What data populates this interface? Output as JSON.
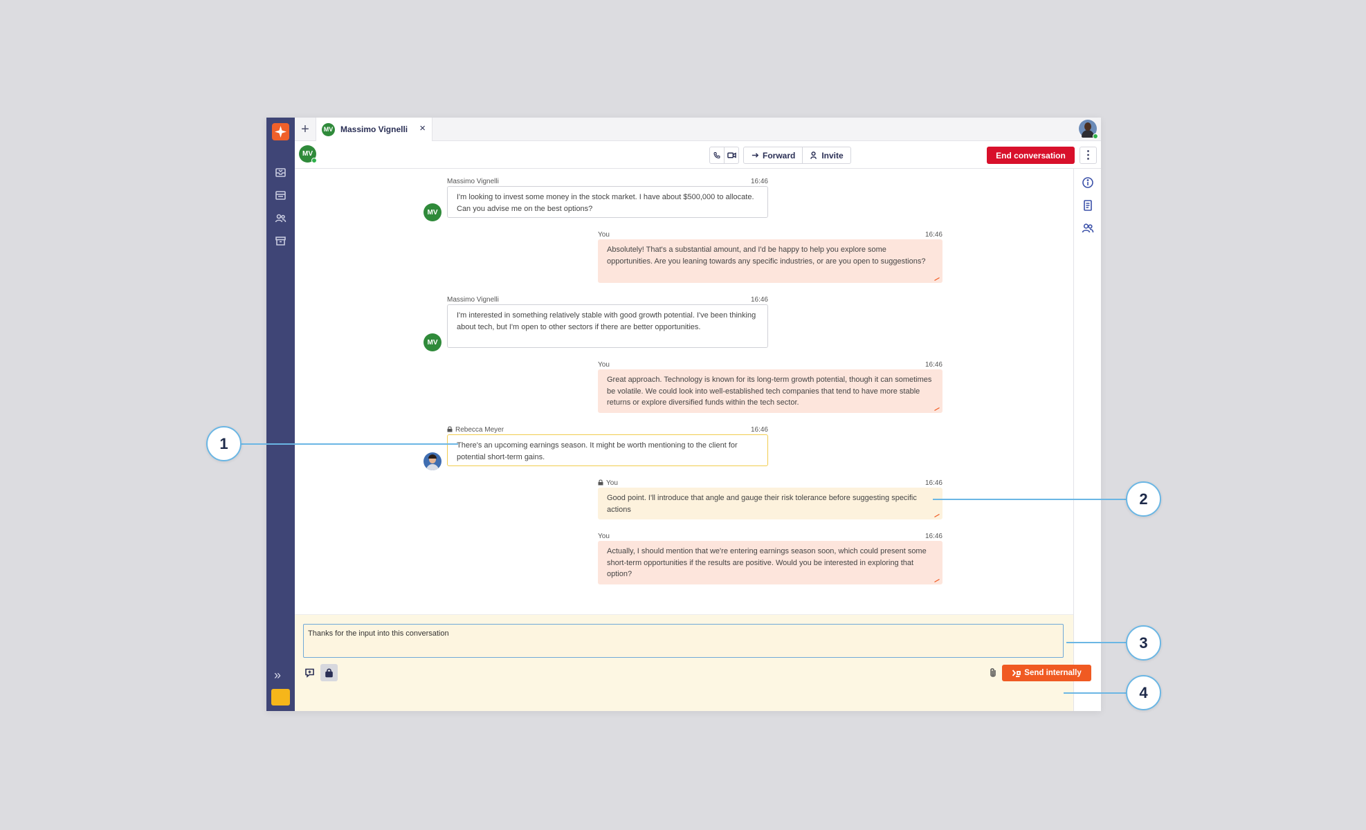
{
  "tabs": {
    "add_label": "+",
    "active": {
      "initials": "MV",
      "name": "Massimo Vignelli",
      "close": "×"
    }
  },
  "header": {
    "contact_initials": "MV",
    "forward_label": "Forward",
    "invite_label": "Invite",
    "end_label": "End conversation",
    "more_label": "⋮"
  },
  "messages": [
    {
      "author": "Massimo Vignelli",
      "time": "16:46",
      "text": "I'm looking to invest some money in the stock market. I have about $500,000 to allocate. Can you advise me on the best options?",
      "type": "in",
      "initials": "MV"
    },
    {
      "author": "You",
      "time": "16:46",
      "text": "Absolutely! That's a substantial amount, and I'd be happy to help you explore some opportunities. Are you leaning towards any specific industries, or are you open to suggestions?",
      "type": "out"
    },
    {
      "author": "Massimo Vignelli",
      "time": "16:46",
      "text": "I'm interested in something relatively stable with good growth potential. I've been thinking about tech, but I'm open to other sectors if there are better opportunities.",
      "type": "in",
      "initials": "MV"
    },
    {
      "author": "You",
      "time": "16:46",
      "text": "Great approach. Technology is known for its long-term growth potential, though it can sometimes be volatile. We could look into well-established tech companies that tend to have more stable returns or explore diversified funds within the tech sector.",
      "type": "out"
    },
    {
      "author": "Rebecca Meyer",
      "time": "16:46",
      "text": "There's an upcoming earnings season. It might be worth mentioning to the client for potential short-term gains.",
      "type": "note"
    },
    {
      "author": "You",
      "time": "16:46",
      "text": "Good point. I'll introduce that angle and gauge their risk tolerance before suggesting specific actions",
      "type": "noteout"
    },
    {
      "author": "You",
      "time": "16:46",
      "text": "Actually, I should mention that we're entering earnings season soon, which could present some short-term opportunities if the results are positive. Would you be interested in exploring that option?",
      "type": "out"
    }
  ],
  "composer": {
    "value": "Thanks for the input into this conversation",
    "send_label": "Send internally"
  },
  "rail": {
    "expand_label": "»"
  },
  "callouts": [
    "1",
    "2",
    "3",
    "4"
  ],
  "colors": {
    "rail": "#3f4576",
    "brand": "#f0602a",
    "end_button": "#d8102b",
    "send_button": "#f05a22",
    "outgoing_bubble": "#fde5dc",
    "internal_note_border": "#f1cc4d",
    "composer_bg": "#fdf7e3",
    "callout": "#6ab6e4"
  },
  "icons": [
    "logo-icon",
    "inbox-icon",
    "calendar-icon",
    "contacts-icon",
    "archive-icon",
    "phone-icon",
    "video-icon",
    "forward-arrow-icon",
    "invite-user-icon",
    "info-icon",
    "notes-icon",
    "participants-icon",
    "comment-icon",
    "lock-icon",
    "paperclip-icon",
    "send-internal-icon"
  ]
}
